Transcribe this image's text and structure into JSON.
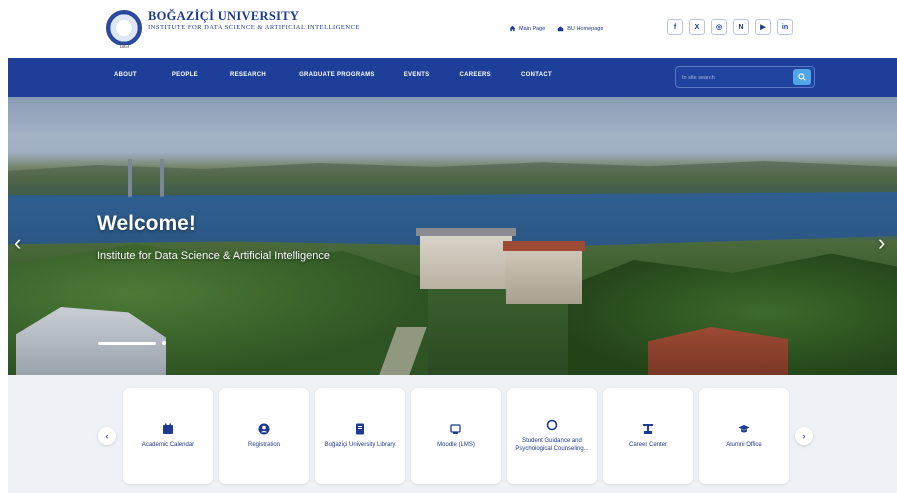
{
  "header": {
    "university": "BOĞAZİÇİ UNIVERSITY",
    "institute": "INSTITUTE FOR DATA SCIENCE & ARTIFICIAL INTELLIGENCE",
    "seal_year": "1863",
    "top_links": [
      {
        "label": "Main Page",
        "icon": "home-icon"
      },
      {
        "label": "BU Homepage",
        "icon": "building-icon"
      }
    ],
    "socials": [
      {
        "label": "f",
        "icon": "facebook-icon"
      },
      {
        "label": "X",
        "icon": "x-icon"
      },
      {
        "label": "◎",
        "icon": "instagram-icon"
      },
      {
        "label": "N",
        "icon": "nsosyal-icon"
      },
      {
        "label": "▶",
        "icon": "youtube-icon"
      },
      {
        "label": "in",
        "icon": "linkedin-icon"
      }
    ]
  },
  "nav": {
    "items": [
      "ABOUT",
      "PEOPLE",
      "RESEARCH",
      "GRADUATE PROGRAMS",
      "EVENTS",
      "CAREERS",
      "CONTACT"
    ],
    "search_placeholder": "In site search"
  },
  "hero": {
    "title": "Welcome!",
    "subtitle": "Institute for Data Science & Artificial Intelligence",
    "slide_count": 2,
    "active_slide": 1
  },
  "quick_links": [
    {
      "label": "Academic Calendar",
      "icon": "calendar-icon"
    },
    {
      "label": "Registration",
      "icon": "user-circle-icon"
    },
    {
      "label": "Boğaziçi University Library",
      "icon": "book-icon"
    },
    {
      "label": "Moodle (LMS)",
      "icon": "moodle-icon"
    },
    {
      "label": "Student Guidance and Psychological Counseling...",
      "icon": "guidance-icon"
    },
    {
      "label": "Career Center",
      "icon": "career-icon"
    },
    {
      "label": "Alumni Office",
      "icon": "graduation-cap-icon"
    }
  ],
  "colors": {
    "brand": "#1e3f99",
    "accent": "#4fa7e8",
    "panel": "#eef1f6"
  }
}
